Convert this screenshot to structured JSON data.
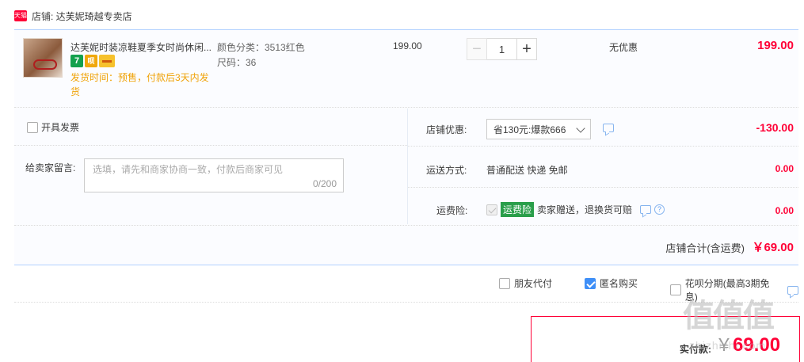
{
  "shop": {
    "badge": "天猫",
    "name": "店铺: 达芙妮琦越专卖店"
  },
  "item": {
    "title": "达芙妮时装凉鞋夏季女时尚休闲...",
    "badges": [
      "7",
      "呗",
      ""
    ],
    "ship_time": "发货时间：预售，付款后3天内发货",
    "sku_color": "颜色分类：3513红色",
    "sku_size": "尺码：36",
    "unit_price": "199.00",
    "quantity": "1",
    "minus": "−",
    "plus": "+",
    "discount": "无优惠",
    "total": "199.00"
  },
  "invoice": {
    "label": "开具发票",
    "checked": false
  },
  "message": {
    "label": "给卖家留言:",
    "placeholder": "选填，请先和商家协商一致，付款后商家可见",
    "counter": "0/200"
  },
  "shop_discount": {
    "label": "店铺优惠:",
    "selected": "省130元:爆款666",
    "value": "-130.00"
  },
  "shipping": {
    "label": "运送方式:",
    "method": "普通配送 快递 免邮",
    "value": "0.00"
  },
  "insurance": {
    "label": "运费险:",
    "tag": "运费险",
    "text": "卖家赠送，退换货可赔",
    "help": "?",
    "value": "0.00"
  },
  "shop_total": {
    "label": "店铺合计(含运费)",
    "value": "￥69.00"
  },
  "options": [
    {
      "label": "朋友代付",
      "checked": false
    },
    {
      "label": "匿名购买",
      "checked": true
    },
    {
      "label": "花呗分期(最高3期免息)",
      "checked": false
    }
  ],
  "payment": {
    "label": "实付款:",
    "yen": "￥",
    "value": "69.00"
  },
  "watermark": {
    "text": "值值值",
    "url": "zhizhizhi.com"
  },
  "colors": {
    "accent_red": "#ff0036",
    "link_blue": "#3f8ff7",
    "ship_orange": "#f0a30a"
  }
}
